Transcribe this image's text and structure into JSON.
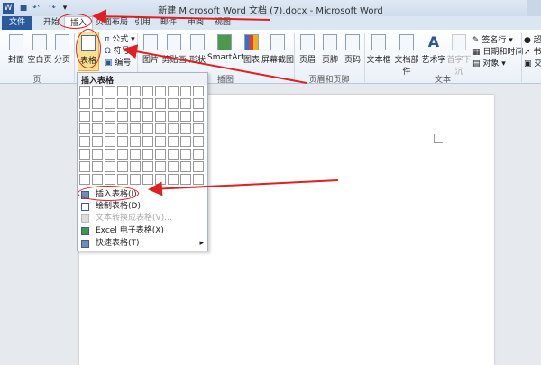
{
  "window": {
    "title": "新建 Microsoft Word 文档 (7).docx - Microsoft Word"
  },
  "quick_access": [
    "word-icon",
    "save-icon",
    "undo-icon",
    "redo-icon",
    "customize-icon"
  ],
  "tabs": [
    {
      "label": "文件"
    },
    {
      "label": "开始"
    },
    {
      "label": "插入",
      "active": true
    },
    {
      "label": "页面布局"
    },
    {
      "label": "引用"
    },
    {
      "label": "邮件"
    },
    {
      "label": "审阅"
    },
    {
      "label": "视图"
    }
  ],
  "ribbon": {
    "pages": {
      "label": "页",
      "buttons": [
        "封面",
        "空白页",
        "分页"
      ]
    },
    "table": {
      "button": "表格"
    },
    "symbols": [
      "公式",
      "符号",
      "编号"
    ],
    "illustrations": {
      "label": "插图",
      "buttons": [
        "图片",
        "剪贴画",
        "形状",
        "SmartArt",
        "图表",
        "屏幕截图"
      ]
    },
    "header_footer": {
      "label": "页眉和页脚",
      "buttons": [
        "页眉",
        "页脚",
        "页码"
      ]
    },
    "text": {
      "label": "文本",
      "buttons": [
        "文本框",
        "文档部件",
        "艺术字",
        "首字下沉"
      ],
      "small": [
        "签名行",
        "日期和时间",
        "对象"
      ]
    },
    "links": {
      "small": [
        "超",
        "书",
        "交"
      ]
    }
  },
  "table_menu": {
    "header": "插入表格",
    "grid": {
      "columns": 10,
      "rows": 8
    },
    "items": [
      {
        "label": "插入表格(I)...",
        "enabled": true
      },
      {
        "label": "绘制表格(D)",
        "enabled": true
      },
      {
        "label": "文本转换成表格(V)...",
        "enabled": false
      },
      {
        "label": "Excel 电子表格(X)",
        "enabled": true
      },
      {
        "label": "快速表格(T)",
        "enabled": true,
        "submenu": true
      }
    ]
  },
  "colors": {
    "file_tab": "#2a5a9e",
    "annotation": "#e02020"
  }
}
